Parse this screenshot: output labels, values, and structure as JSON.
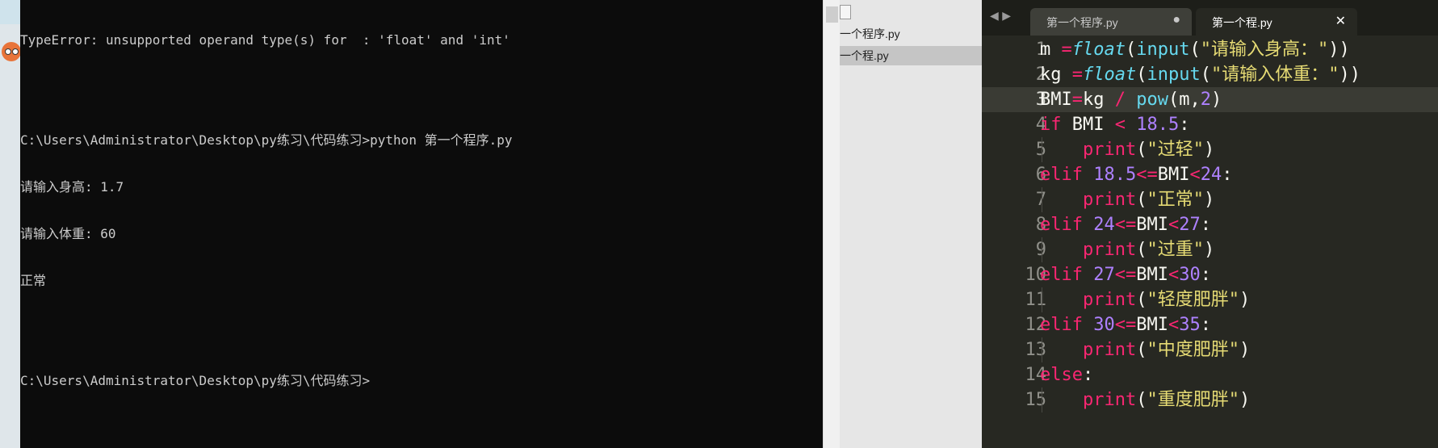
{
  "console": {
    "lines": [
      "TypeError: unsupported operand type(s) for  : 'float' and 'int'",
      "",
      "C:\\Users\\Administrator\\Desktop\\py练习\\代码练习>python 第一个程序.py",
      "请输入身高: 1.7",
      "请输入体重: 60",
      "正常",
      "",
      "C:\\Users\\Administrator\\Desktop\\py练习\\代码练习>"
    ]
  },
  "sidebar": {
    "files": [
      {
        "label": "一个程序.py",
        "active": false
      },
      {
        "label": "一个程.py",
        "active": true
      }
    ]
  },
  "editor": {
    "nav_arrows": "◀ ▶",
    "tabs": [
      {
        "label": "第一个程序.py",
        "button": "●"
      },
      {
        "label": "第一个程.py",
        "button": "✕"
      }
    ],
    "current_line": 3,
    "line_numbers": [
      "1",
      "2",
      "3",
      "4",
      "5",
      "6",
      "7",
      "8",
      "9",
      "10",
      "11",
      "12",
      "13",
      "14",
      "15"
    ]
  },
  "colors": {
    "keyword": "#f92672",
    "builtin": "#66d9ef",
    "number": "#ae81ff",
    "string": "#e6db74",
    "editor_bg": "#272822"
  }
}
